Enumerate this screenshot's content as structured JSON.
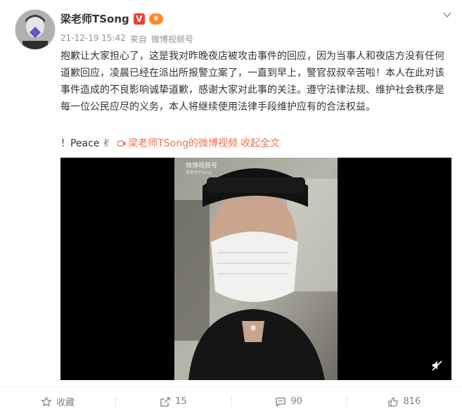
{
  "user": {
    "name": "梁老师TSong",
    "vip_badge": "V"
  },
  "meta": {
    "time": "21-12-19 15:42",
    "source_prefix": "来自",
    "source": "微博视频号"
  },
  "post": {
    "text": "抱歉让大家担心了，这是我对昨晚夜店被攻击事件的回应，因为当事人和夜店方没有任何道歉回应，凌晨已经在派出所报警立案了，一直到早上，警官叔叔辛苦啦！本人在此对该事件造成的不良影响诚挚道歉，感谢大家对此事的关注。遵守法律法规、维护社会秩序是每一位公民应尽的义务，本人将继续使用法律手段维护应有的合法权益。",
    "peace": "！Peace",
    "peace_emoji": "✌",
    "video_link": "梁老师TSong的微博视频",
    "collapse": "收起全文"
  },
  "video": {
    "watermark": "微博视频号",
    "watermark_sub": "梁老师TSong"
  },
  "actions": {
    "favorite": "收藏",
    "repost": "15",
    "comment": "90",
    "like": "816"
  },
  "colors": {
    "link": "#eb7350",
    "text": "#333333",
    "meta": "#939393"
  }
}
